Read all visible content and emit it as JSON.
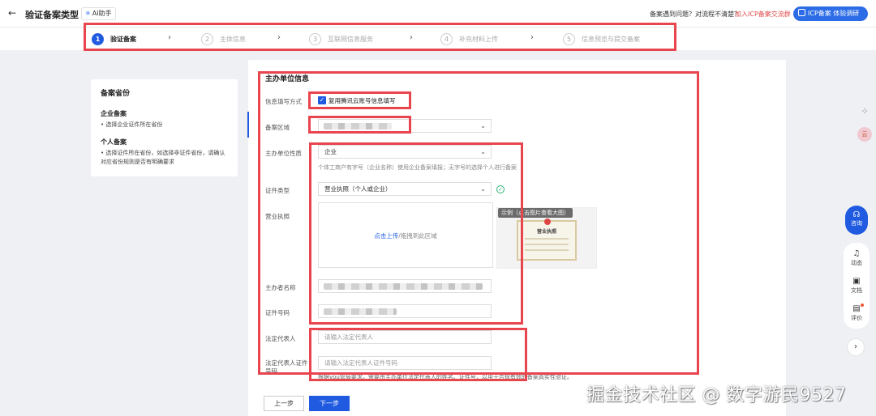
{
  "header": {
    "back_icon": "arrow-left-icon",
    "title": "验证备案类型",
    "ai_assistant_label": "AI助手",
    "help_text": "备案遇到问题？对流程不清楚？",
    "help_link": "加入ICP备案交流群",
    "icp_button_label": "ICP备案 体验调研"
  },
  "steps": [
    {
      "num": "1",
      "label": "验证备案"
    },
    {
      "num": "2",
      "label": "主体信息"
    },
    {
      "num": "3",
      "label": "互联网信息服务"
    },
    {
      "num": "4",
      "label": "补充材料上传"
    },
    {
      "num": "5",
      "label": "信息预览与提交备案"
    }
  ],
  "sidebar": {
    "title": "备案省份",
    "sections": [
      {
        "heading": "企业备案",
        "items": [
          "• 选择企业证件所在省份"
        ]
      },
      {
        "heading": "个人备案",
        "items": [
          "• 选择证件所在省份，如选择非证件省份，请确认对应省份规则是否有明确要求"
        ]
      }
    ]
  },
  "form": {
    "section_title": "主办单位信息",
    "fill_method_label": "信息填写方式",
    "fill_method_checkbox": "复用腾讯云账号信息填写",
    "region_label": "备案区域",
    "org_type_label": "主办单位性质",
    "org_type_value": "企业",
    "org_type_note": "个体工商户有字号（企业名称）使用企业备案填报；无字号的选择个人进行备案",
    "cert_type_label": "证件类型",
    "cert_type_value": "营业执照（个人或企业）",
    "license_label": "营业执照",
    "upload_link": "点击上传",
    "upload_hint": "/拖拽到此区域",
    "sample_caption": "示例（点击图片查看大图）",
    "sample_license_text": "营业执照",
    "sponsor_name_label": "主办者名称",
    "cert_number_label": "证件号码",
    "legal_rep_label": "法定代表人",
    "legal_rep_placeholder": "请输入法定代表人",
    "legal_rep_id_label": "法定代表人证件号码",
    "legal_rep_id_placeholder": "请输入法定代表人证件号码",
    "footer_note": "根据you管局要求，需要由主办单位法定代表人的姓名、证件号，以用于合规有效的备案真实性验证。"
  },
  "actions": {
    "prev_label": "上一步",
    "next_label": "下一步"
  },
  "right_rail": {
    "consult_label": "咨询",
    "dynamics_label": "动态",
    "docs_label": "文档",
    "review_label": "评价",
    "avatar_text": "云"
  },
  "watermark": "掘金技术社区 @ 数字游民9527",
  "colors": {
    "accent": "#1f5ae0",
    "highlight_box": "#e8454f",
    "success": "#2bb673"
  }
}
